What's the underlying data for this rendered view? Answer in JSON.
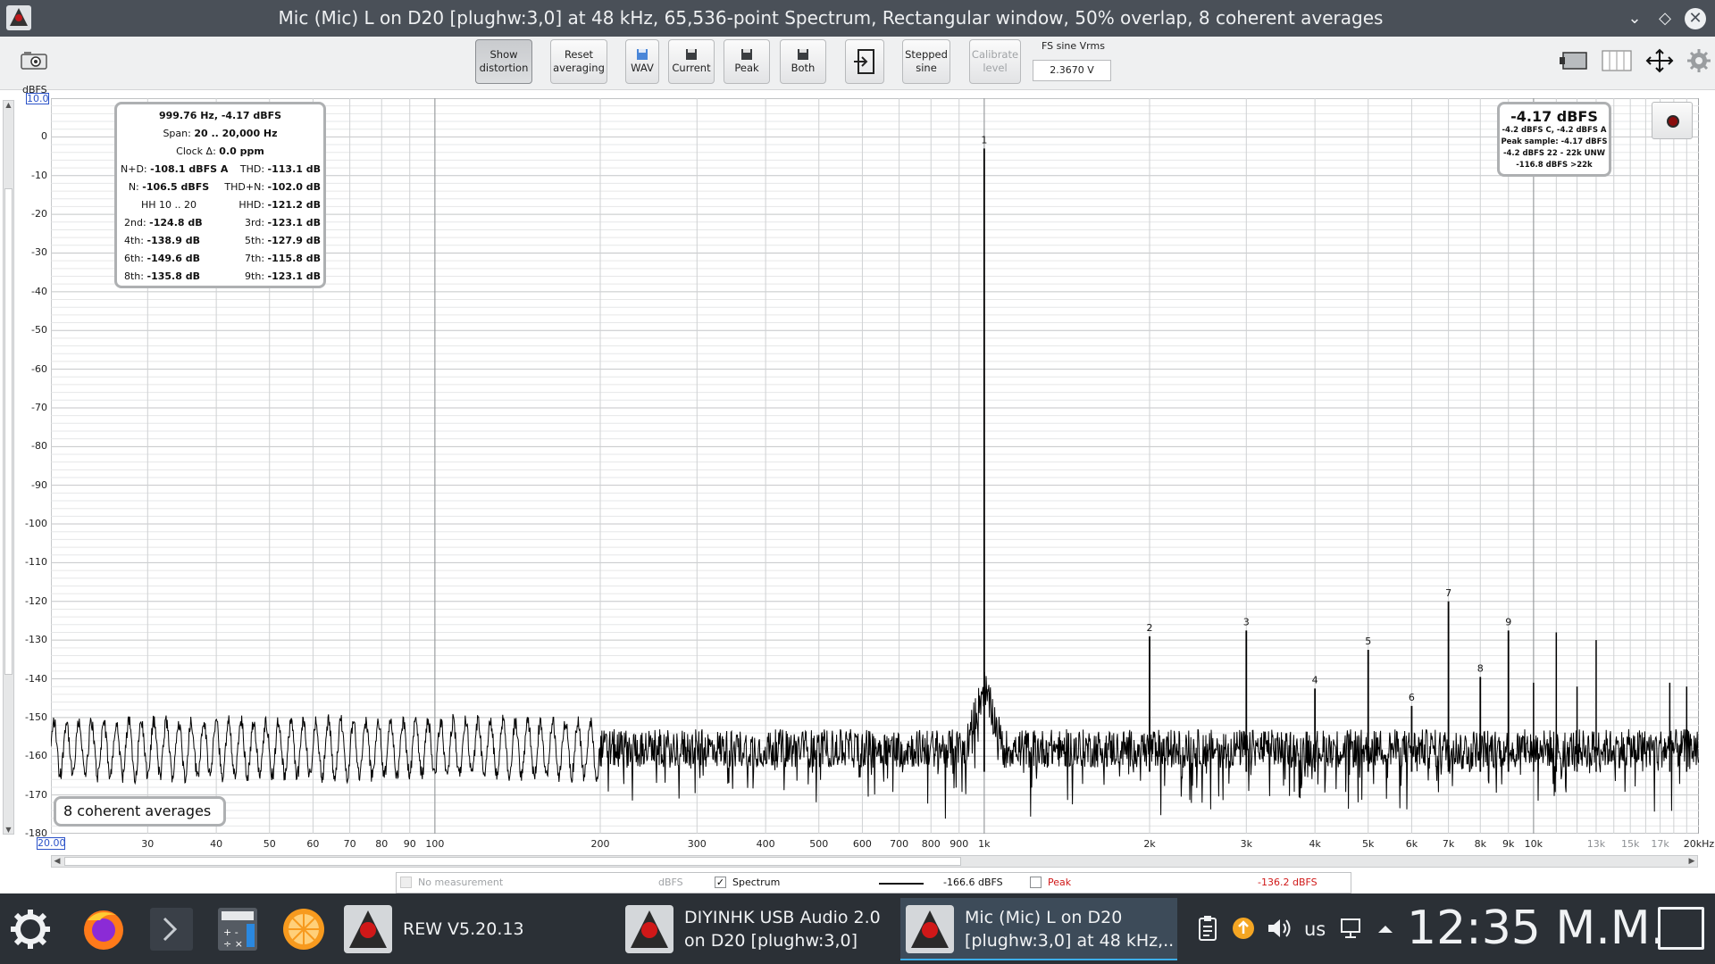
{
  "window": {
    "title": "Mic (Mic) L on D20 [plughw:3,0] at 48 kHz, 65,536-point Spectrum, Rectangular window, 50% overlap, 8 coherent averages",
    "icon": "rew-app-icon",
    "controls": [
      "minimize-icon",
      "maximize-icon",
      "close-icon"
    ]
  },
  "toolbar": {
    "buttons": [
      {
        "line1": "Show",
        "line2": "distortion",
        "state": "pressed"
      },
      {
        "line1": "Reset",
        "line2": "averaging",
        "state": "normal"
      },
      {
        "line1": "WAV",
        "line2": "",
        "icon": "save-icon-blue",
        "state": "normal"
      },
      {
        "line1": "Current",
        "line2": "",
        "icon": "save-icon",
        "state": "normal"
      },
      {
        "line1": "Peak",
        "line2": "",
        "icon": "save-icon",
        "state": "normal"
      },
      {
        "line1": "Both",
        "line2": "",
        "icon": "save-icon",
        "state": "normal"
      },
      {
        "line1": "",
        "line2": "",
        "icon": "import-icon",
        "state": "normal"
      },
      {
        "line1": "Stepped",
        "line2": "sine",
        "state": "normal"
      },
      {
        "line1": "Calibrate",
        "line2": "level",
        "state": "disabled"
      }
    ],
    "fs_sine_label": "FS sine Vrms",
    "fs_sine_value": "2.3670 V"
  },
  "graph": {
    "y_unit": "dBFS",
    "y_max": "10.0",
    "y_ticks": [
      "0",
      "-10",
      "-20",
      "-30",
      "-40",
      "-50",
      "-60",
      "-70",
      "-80",
      "-90",
      "-100",
      "-110",
      "-120",
      "-130",
      "-140",
      "-150",
      "-160",
      "-170",
      "-180"
    ],
    "x_min": "20.00",
    "x_ticks": [
      {
        "label": "30",
        "v": 30
      },
      {
        "label": "40",
        "v": 40
      },
      {
        "label": "50",
        "v": 50
      },
      {
        "label": "60",
        "v": 60
      },
      {
        "label": "70",
        "v": 70
      },
      {
        "label": "80",
        "v": 80
      },
      {
        "label": "90",
        "v": 90
      },
      {
        "label": "100",
        "v": 100
      },
      {
        "label": "200",
        "v": 200
      },
      {
        "label": "300",
        "v": 300
      },
      {
        "label": "400",
        "v": 400
      },
      {
        "label": "500",
        "v": 500
      },
      {
        "label": "600",
        "v": 600
      },
      {
        "label": "700",
        "v": 700
      },
      {
        "label": "800",
        "v": 800
      },
      {
        "label": "900",
        "v": 900
      },
      {
        "label": "1k",
        "v": 1000
      },
      {
        "label": "2k",
        "v": 2000
      },
      {
        "label": "3k",
        "v": 3000
      },
      {
        "label": "4k",
        "v": 4000
      },
      {
        "label": "5k",
        "v": 5000
      },
      {
        "label": "6k",
        "v": 6000
      },
      {
        "label": "7k",
        "v": 7000
      },
      {
        "label": "8k",
        "v": 8000
      },
      {
        "label": "9k",
        "v": 9000
      },
      {
        "label": "10k",
        "v": 10000
      },
      {
        "label": "13k",
        "v": 13000,
        "light": true
      },
      {
        "label": "15k",
        "v": 15000,
        "light": true
      },
      {
        "label": "17k",
        "v": 17000,
        "light": true
      },
      {
        "label": "20kHz",
        "v": 20000
      }
    ],
    "harmonic_markers": [
      {
        "label": "1",
        "f": 1000,
        "db": -3
      },
      {
        "label": "2",
        "f": 2000,
        "db": -129
      },
      {
        "label": "3",
        "f": 3000,
        "db": -127.5
      },
      {
        "label": "4",
        "f": 4000,
        "db": -142.5
      },
      {
        "label": "5",
        "f": 5000,
        "db": -132.5
      },
      {
        "label": "6",
        "f": 6000,
        "db": -147
      },
      {
        "label": "7",
        "f": 7000,
        "db": -120
      },
      {
        "label": "8",
        "f": 8000,
        "db": -139.5
      },
      {
        "label": "9",
        "f": 9000,
        "db": -127.5
      }
    ],
    "extra_spurs": [
      {
        "f": 11000,
        "db": -128
      },
      {
        "f": 13000,
        "db": -130
      },
      {
        "f": 10000,
        "db": -141
      },
      {
        "f": 12000,
        "db": -142
      },
      {
        "f": 17700,
        "db": -141
      },
      {
        "f": 19000,
        "db": -142
      }
    ],
    "noise_floor_db": -158
  },
  "distortion_panel": {
    "header": "999.76 Hz, -4.17 dBFS",
    "span_label": "Span:",
    "span_value": "20 .. 20,000 Hz",
    "clock_label": "Clock Δ:",
    "clock_value": "0.0 ppm",
    "nd_label": "N+D:",
    "nd_value": "-108.1 dBFS A",
    "thd_label": "THD:",
    "thd_value": "-113.1 dB",
    "n_label": "N:",
    "n_value": "-106.5 dBFS",
    "thdn_label": "THD+N:",
    "thdn_value": "-102.0 dB",
    "hh_label": "HH 10 .. 20",
    "hhd_label": "HHD:",
    "hhd_value": "-121.2 dB",
    "h2_label": "2nd:",
    "h2_value": "-124.8 dB",
    "h3_label": "3rd:",
    "h3_value": "-123.1 dB",
    "h4_label": "4th:",
    "h4_value": "-138.9 dB",
    "h5_label": "5th:",
    "h5_value": "-127.9 dB",
    "h6_label": "6th:",
    "h6_value": "-149.6 dB",
    "h7_label": "7th:",
    "h7_value": "-115.8 dB",
    "h8_label": "8th:",
    "h8_value": "-135.8 dB",
    "h9_label": "9th:",
    "h9_value": "-123.1 dB"
  },
  "level_panel": {
    "main": "-4.17 dBFS",
    "line1": "-4.2 dBFS C, -4.2 dBFS A",
    "line2": "Peak sample: -4.17 dBFS",
    "line3": "-4.2 dBFS 22 - 22k UNW",
    "line4": "-116.8 dBFS >22k"
  },
  "averages_badge": "8 coherent averages",
  "legend": {
    "no_measurement": "No measurement",
    "unit": "dBFS",
    "spectrum_label": "Spectrum",
    "spectrum_checked": true,
    "spectrum_value": "-166.6 dBFS",
    "peak_label": "Peak",
    "peak_checked": false,
    "peak_value": "-136.2 dBFS",
    "peak_color": "#d01818"
  },
  "taskbar": {
    "tasks": [
      {
        "label1": "REW V5.20.13",
        "label2": ""
      },
      {
        "label1": "DIYINHK USB Audio 2.0",
        "label2": "on D20 [plughw:3,0]"
      },
      {
        "label1": "Mic (Mic) L on D20",
        "label2": "[plughw:3,0] at 48 kHz,..."
      }
    ],
    "keyboard_layout": "us",
    "clock": "12:35 M.M."
  }
}
